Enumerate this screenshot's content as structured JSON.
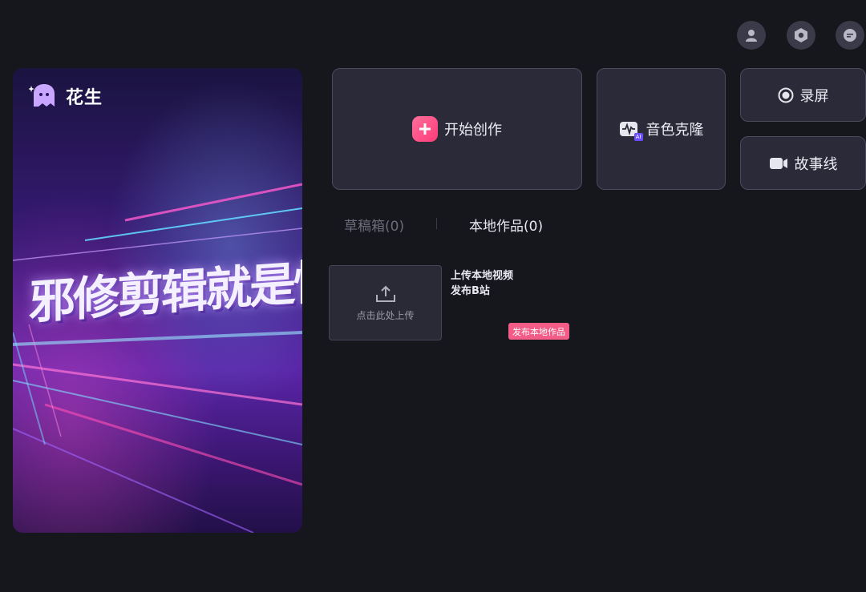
{
  "top_icons": [
    {
      "name": "user-icon"
    },
    {
      "name": "settings-icon"
    },
    {
      "name": "message-icon"
    }
  ],
  "banner": {
    "brand_name": "花生",
    "slogan": "邪修剪辑就是快"
  },
  "actions": {
    "start_create": "开始创作",
    "voice_clone": "音色克隆",
    "voice_clone_badge": "AI",
    "screen_record": "录屏",
    "storyline": "故事线"
  },
  "tabs": [
    {
      "label": "草稿箱(0)",
      "active": false
    },
    {
      "label": "本地作品(0)",
      "active": true
    }
  ],
  "upload": {
    "label": "点击此处上传",
    "info_line1": "上传本地视频",
    "info_line2": "发布B站",
    "publish_badge": "发布本地作品"
  },
  "colors": {
    "background": "#16161d",
    "card": "#2a2a38",
    "accent_pink": "#f25c86",
    "tab_inactive": "#6c6c7c"
  }
}
